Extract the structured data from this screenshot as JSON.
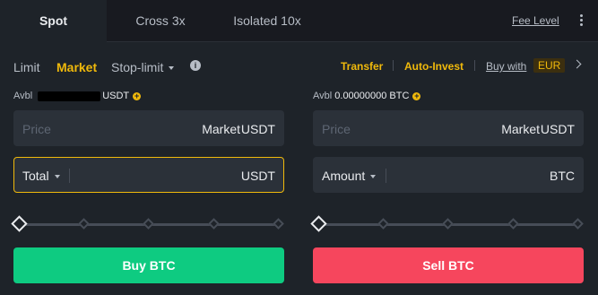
{
  "tabs": [
    {
      "label": "Spot",
      "active": true
    },
    {
      "label": "Cross 3x",
      "active": false
    },
    {
      "label": "Isolated 10x",
      "active": false
    }
  ],
  "fee_level": "Fee Level",
  "order_types": {
    "limit": "Limit",
    "market": "Market",
    "stop_limit": "Stop-limit",
    "active": "Market"
  },
  "links": {
    "transfer": "Transfer",
    "auto_invest": "Auto-Invest",
    "buy_with": "Buy with",
    "currency": "EUR"
  },
  "buy": {
    "avbl_label": "Avbl",
    "avbl_unit": "USDT",
    "price_placeholder": "Price",
    "price_value": "Market",
    "price_unit": "USDT",
    "total_label": "Total",
    "total_unit": "USDT",
    "button": "Buy BTC"
  },
  "sell": {
    "avbl_label": "Avbl",
    "avbl_value": "0.00000000 BTC",
    "price_placeholder": "Price",
    "price_value": "Market",
    "price_unit": "USDT",
    "amount_label": "Amount",
    "amount_unit": "BTC",
    "button": "Sell BTC"
  },
  "slider_value": 0,
  "colors": {
    "accent": "#f0b90b",
    "buy": "#0ecb81",
    "sell": "#f6465d",
    "background": "#1e2329"
  }
}
